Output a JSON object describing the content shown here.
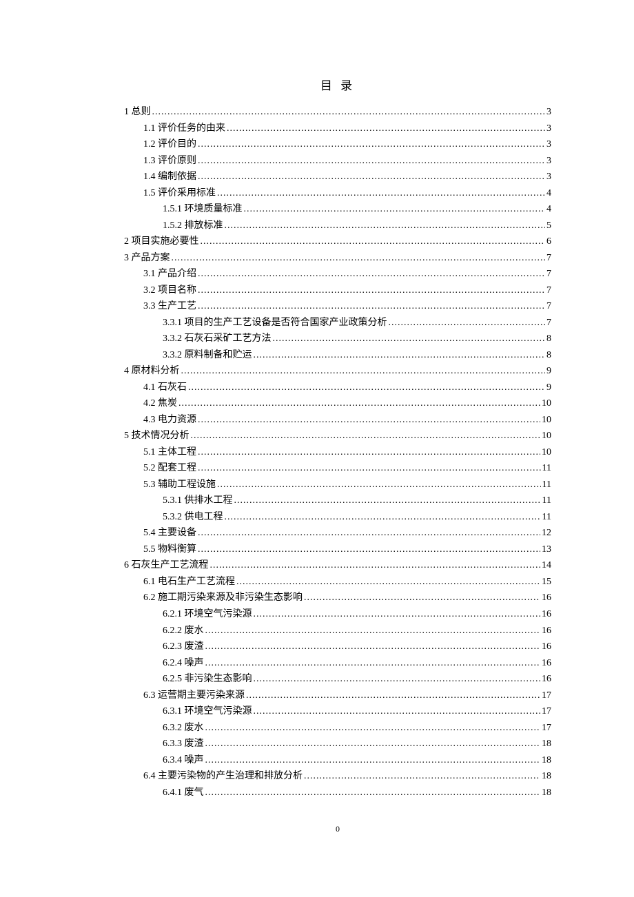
{
  "title": "目 录",
  "footer": "0",
  "toc": [
    {
      "level": 0,
      "label": "1 总则",
      "page": "3"
    },
    {
      "level": 1,
      "label": "1.1 评价任务的由来",
      "page": "3"
    },
    {
      "level": 1,
      "label": "1.2 评价目的",
      "page": "3"
    },
    {
      "level": 1,
      "label": "1.3 评价原则",
      "page": "3"
    },
    {
      "level": 1,
      "label": "1.4 编制依据",
      "page": "3"
    },
    {
      "level": 1,
      "label": "1.5 评价采用标准",
      "page": "4"
    },
    {
      "level": 2,
      "label": "1.5.1 环境质量标准",
      "page": "4"
    },
    {
      "level": 2,
      "label": "1.5.2 排放标准",
      "page": "5"
    },
    {
      "level": 0,
      "label": "2 项目实施必要性",
      "page": "6"
    },
    {
      "level": 0,
      "label": "3 产品方案",
      "page": "7"
    },
    {
      "level": 1,
      "label": "3.1 产品介绍",
      "page": "7"
    },
    {
      "level": 1,
      "label": "3.2 项目名称",
      "page": "7"
    },
    {
      "level": 1,
      "label": "3.3 生产工艺",
      "page": "7"
    },
    {
      "level": 2,
      "label": "3.3.1 项目的生产工艺设备是否符合国家产业政策分析",
      "page": "7"
    },
    {
      "level": 2,
      "label": "3.3.2 石灰石采矿工艺方法",
      "page": "8"
    },
    {
      "level": 2,
      "label": "3.3.2 原料制备和贮运",
      "page": "8"
    },
    {
      "level": 0,
      "label": "4 原材料分析",
      "page": "9"
    },
    {
      "level": 1,
      "label": "4.1 石灰石",
      "page": "9"
    },
    {
      "level": 1,
      "label": "4.2 焦炭",
      "page": "10"
    },
    {
      "level": 1,
      "label": "4.3 电力资源",
      "page": "10"
    },
    {
      "level": 0,
      "label": "5 技术情况分析",
      "page": "10"
    },
    {
      "level": 1,
      "label": "5.1 主体工程",
      "page": "10"
    },
    {
      "level": 1,
      "label": "5.2 配套工程",
      "page": "11"
    },
    {
      "level": 1,
      "label": "5.3 辅助工程设施",
      "page": "11"
    },
    {
      "level": 2,
      "label": "5.3.1 供排水工程",
      "page": "11"
    },
    {
      "level": 2,
      "label": "5.3.2 供电工程",
      "page": "11"
    },
    {
      "level": 1,
      "label": "5.4 主要设备",
      "page": "12"
    },
    {
      "level": 1,
      "label": "5.5 物料衡算",
      "page": "13"
    },
    {
      "level": 0,
      "label": "6 石灰生产工艺流程",
      "page": "14"
    },
    {
      "level": 1,
      "label": "6.1 电石生产工艺流程",
      "page": "15"
    },
    {
      "level": 1,
      "label": "6.2 施工期污染来源及非污染生态影响",
      "page": "16"
    },
    {
      "level": 2,
      "label": "6.2.1 环境空气污染源",
      "page": "16"
    },
    {
      "level": 2,
      "label": "6.2.2 废水",
      "page": "16"
    },
    {
      "level": 2,
      "label": "6.2.3 废渣",
      "page": "16"
    },
    {
      "level": 2,
      "label": "6.2.4 噪声",
      "page": "16"
    },
    {
      "level": 2,
      "label": "6.2.5 非污染生态影响",
      "page": "16"
    },
    {
      "level": 1,
      "label": "6.3 运营期主要污染来源",
      "page": "17"
    },
    {
      "level": 2,
      "label": "6.3.1 环境空气污染源",
      "page": "17"
    },
    {
      "level": 2,
      "label": "6.3.2 废水",
      "page": "17"
    },
    {
      "level": 2,
      "label": "6.3.3 废渣",
      "page": "18"
    },
    {
      "level": 2,
      "label": "6.3.4 噪声",
      "page": "18"
    },
    {
      "level": 1,
      "label": "6.4 主要污染物的产生治理和排放分析",
      "page": "18"
    },
    {
      "level": 2,
      "label": "6.4.1 废气",
      "page": "18"
    }
  ]
}
